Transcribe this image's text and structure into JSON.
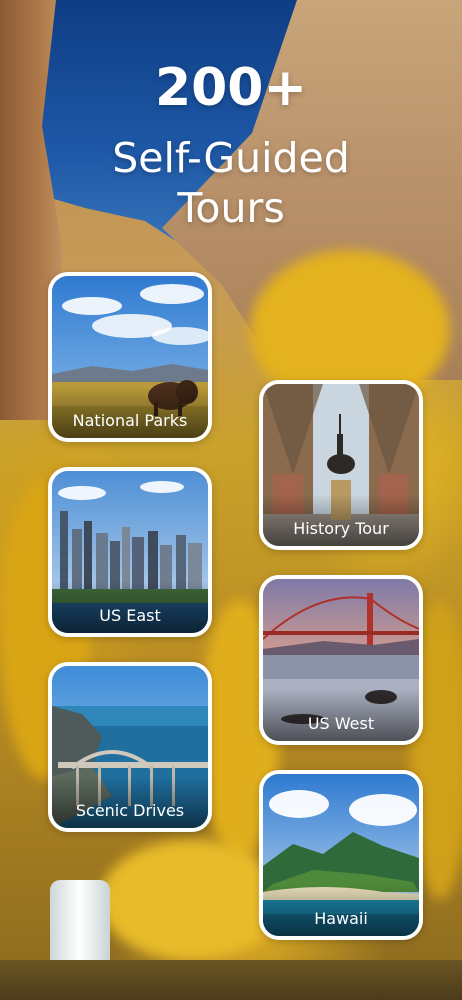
{
  "headline": {
    "count": "200+",
    "line1": "Self-Guided",
    "line2": "Tours"
  },
  "tours": [
    {
      "label": "National Parks",
      "icon": "bison-prairie-image"
    },
    {
      "label": "History Tour",
      "icon": "equestrian-statue-image"
    },
    {
      "label": "US East",
      "icon": "city-skyline-image"
    },
    {
      "label": "US West",
      "icon": "golden-gate-bridge-image"
    },
    {
      "label": "Scenic Drives",
      "icon": "coastal-bridge-image"
    },
    {
      "label": "Hawaii",
      "icon": "island-mountains-image"
    }
  ],
  "colors": {
    "sky": "#1f59a8",
    "foliage": "#e2b024",
    "text": "#ffffff"
  }
}
